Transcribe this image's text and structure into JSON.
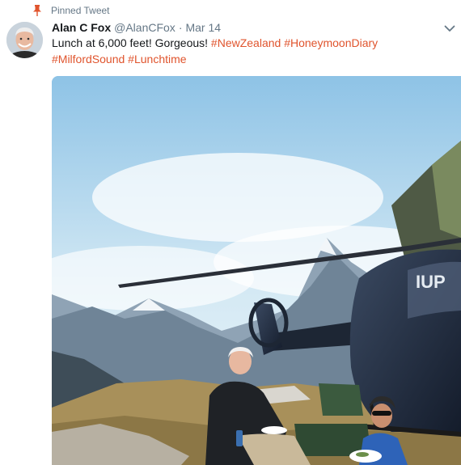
{
  "pinned": {
    "label": "Pinned Tweet",
    "icon": "pin-icon",
    "color": "#e0542d"
  },
  "author": {
    "display_name": "Alan C Fox",
    "handle": "@AlanCFox",
    "separator": "·",
    "timestamp": "Mar 14"
  },
  "tweet": {
    "text_lead": "Lunch at 6,000 feet! Gorgeous! ",
    "hashtags": [
      "#NewZealand",
      "#HoneymoonDiary",
      "#MilfordSound",
      "#Lunchtime"
    ]
  },
  "media": {
    "helicopter_registration": "IUP"
  },
  "menu": {
    "icon": "chevron-down-icon"
  },
  "colors": {
    "accent": "#e0542d",
    "muted": "#657786",
    "text": "#14171a"
  }
}
